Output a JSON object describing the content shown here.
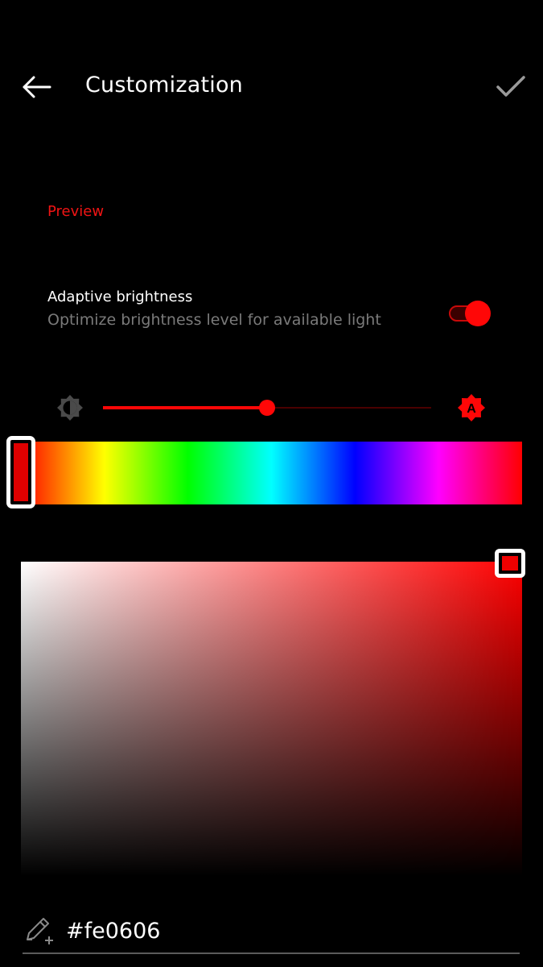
{
  "header": {
    "title": "Customization",
    "back_icon": "arrow-left-icon",
    "confirm_icon": "check-icon"
  },
  "preview": {
    "label": "Preview"
  },
  "adaptive_brightness": {
    "title": "Adaptive brightness",
    "summary": "Optimize brightness level for available light",
    "enabled": true
  },
  "brightness": {
    "low_icon": "brightness-low-icon",
    "auto_icon": "brightness-auto-icon",
    "level_fraction": 0.5
  },
  "color_picker": {
    "hue_degrees": 0,
    "saturation_fraction": 0.98,
    "value_fraction": 1.0
  },
  "hex_field": {
    "value": "#fe0606",
    "icon": "edit-add-icon"
  },
  "colors": {
    "background": "#000000",
    "accent": "#ff0707",
    "preview_label": "#f01414",
    "secondary_text": "#7a7a7a",
    "selected_color": "#fe0606"
  }
}
